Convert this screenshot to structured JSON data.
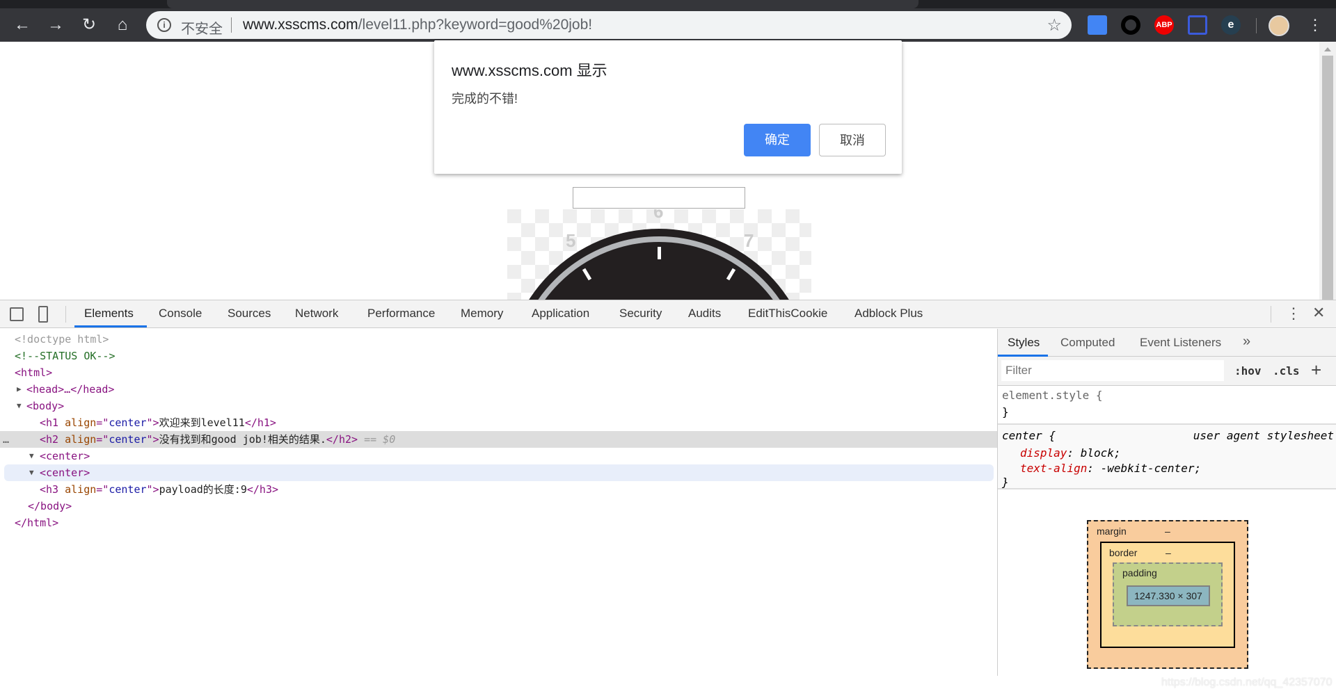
{
  "browser": {
    "insecure_label": "不安全",
    "url_host": "www.xsscms.com",
    "url_path": "/level11.php?keyword=good%20job!",
    "extensions": [
      "google-translate-icon",
      "circle-extension-icon",
      "adblock-plus-icon",
      "tab-extension-icon",
      "e-extension-icon"
    ]
  },
  "dialog": {
    "title": "www.xsscms.com 显示",
    "message": "完成的不错!",
    "ok": "确定",
    "cancel": "取消"
  },
  "clock": {
    "labels": [
      "5",
      "6",
      "7"
    ]
  },
  "devtools": {
    "tabs": [
      "Elements",
      "Console",
      "Sources",
      "Network",
      "Performance",
      "Memory",
      "Application",
      "Security",
      "Audits",
      "EditThisCookie",
      "Adblock Plus"
    ],
    "active_tab": "Elements",
    "dom": {
      "doctype": "<!doctype html>",
      "comment": "<!--STATUS OK-->",
      "html_open": "<html>",
      "head": "<head>…</head>",
      "body_open": "<body>",
      "h1_text": "欢迎来到level11",
      "h2_text": "没有找到和good job!相关的结果.",
      "selected_marker": "== $0",
      "center1": "<center>",
      "center2": "<center>",
      "h3_text": "payload的长度:9",
      "body_close": "</body>",
      "html_close": "</html>"
    },
    "styles": {
      "tabs": [
        "Styles",
        "Computed",
        "Event Listeners"
      ],
      "filter_placeholder": "Filter",
      "hov": ":hov",
      "cls": ".cls",
      "element_style": "element.style {",
      "close_brace": "}",
      "rule_selector": "center {",
      "rule_source": "user agent stylesheet",
      "props": [
        {
          "name": "display",
          "value": "block;"
        },
        {
          "name": "text-align",
          "value": "-webkit-center;"
        }
      ]
    },
    "box_model": {
      "margin": "margin",
      "border": "border",
      "padding": "padding",
      "content": "1247.330 × 307",
      "dash": "–"
    }
  },
  "watermark": "https://blog.csdn.net/qq_42357070"
}
